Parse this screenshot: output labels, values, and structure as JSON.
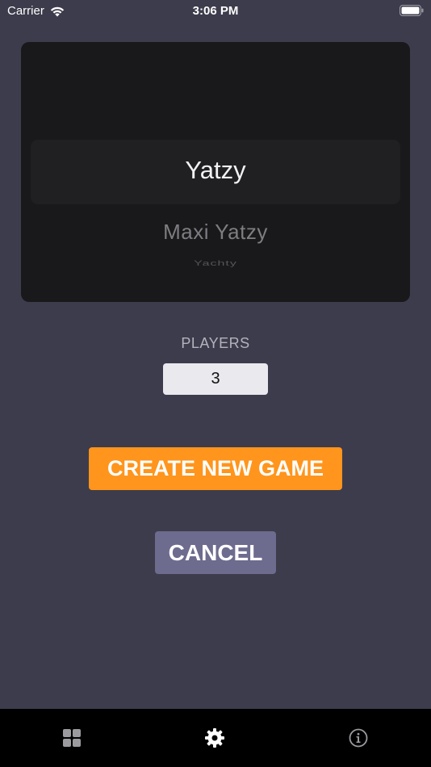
{
  "status_bar": {
    "carrier": "Carrier",
    "time": "3:06 PM",
    "icons": [
      "wifi-icon",
      "battery-icon"
    ]
  },
  "picker": {
    "options": [
      "Yatzy",
      "Maxi Yatzy",
      "Yachty"
    ],
    "selected": "Yatzy"
  },
  "players": {
    "label": "PLAYERS",
    "value": "3"
  },
  "buttons": {
    "create_label": "CREATE NEW GAME",
    "cancel_label": "CANCEL"
  },
  "tab_bar": {
    "tabs": [
      {
        "icon": "grid-icon",
        "active": false
      },
      {
        "icon": "gear-icon",
        "active": true
      },
      {
        "icon": "info-icon",
        "active": false
      }
    ]
  },
  "colors": {
    "background": "#3d3c4c",
    "picker_background": "#19191b",
    "create_button": "#ff951c",
    "cancel_button": "#6d6b8e",
    "tab_bar": "#000000",
    "stepper_background": "#e9e9ee"
  }
}
